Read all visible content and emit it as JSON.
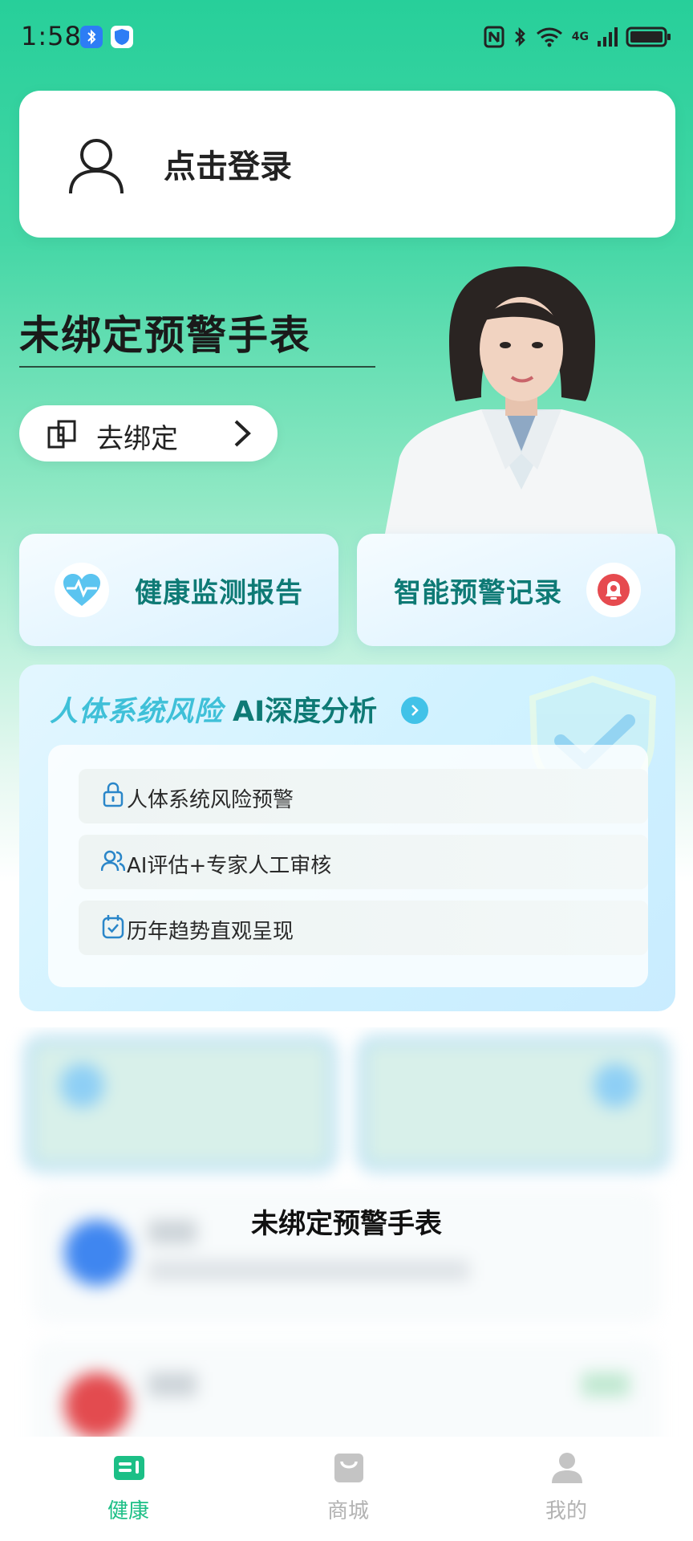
{
  "status_bar": {
    "time": "1:58",
    "network_label": "4G"
  },
  "login": {
    "label": "点击登录"
  },
  "watch": {
    "title": "未绑定预警手表",
    "bind_button_label": "去绑定"
  },
  "features": [
    {
      "label": "健康监测报告",
      "icon": "heartbeat-icon"
    },
    {
      "label": "智能预警记录",
      "icon": "alarm-bell-icon"
    }
  ],
  "ai_panel": {
    "title_italic": "人体系统风险",
    "title_strong": "AI深度分析",
    "items": [
      {
        "label": "人体系统风险预警",
        "icon": "lock-icon"
      },
      {
        "label": "AI评估+专家人工审核",
        "icon": "users-icon"
      },
      {
        "label": "历年趋势直观呈现",
        "icon": "calendar-check-icon"
      }
    ]
  },
  "blurred": {
    "overlay_text": "未绑定预警手表"
  },
  "tabs": [
    {
      "label": "健康",
      "active": true
    },
    {
      "label": "商城",
      "active": false
    },
    {
      "label": "我的",
      "active": false
    }
  ],
  "colors": {
    "accent": "#1cbf86",
    "teal_text": "#0e7a75",
    "cyan_title": "#3fc0d8"
  }
}
